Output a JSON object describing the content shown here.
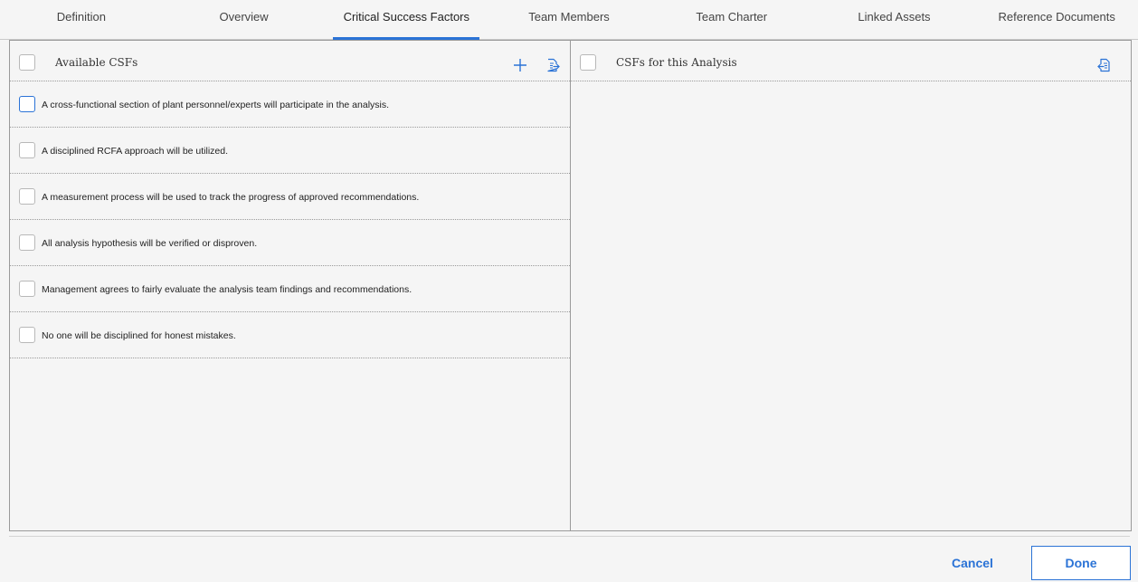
{
  "tabs": [
    {
      "label": "Definition"
    },
    {
      "label": "Overview"
    },
    {
      "label": "Critical Success Factors",
      "active": true
    },
    {
      "label": "Team Members"
    },
    {
      "label": "Team Charter"
    },
    {
      "label": "Linked Assets"
    },
    {
      "label": "Reference Documents"
    }
  ],
  "left_panel": {
    "title": "Available CSFs",
    "icons": [
      "plus-icon",
      "move-right-icon"
    ],
    "items": [
      {
        "text": "A cross-functional section of plant personnel/experts will participate in the analysis."
      },
      {
        "text": "A disciplined RCFA approach will be utilized."
      },
      {
        "text": "A measurement process will be used to track the progress of approved recommendations."
      },
      {
        "text": "All analysis hypothesis will be verified or disproven."
      },
      {
        "text": "Management agrees to fairly evaluate the analysis team findings and recommendations."
      },
      {
        "text": "No one will be disciplined for honest mistakes."
      }
    ]
  },
  "right_panel": {
    "title": "CSFs for this Analysis",
    "icons": [
      "move-left-icon"
    ],
    "items": []
  },
  "footer": {
    "cancel_label": "Cancel",
    "done_label": "Done"
  },
  "colors": {
    "accent": "#2b73d6",
    "background": "#f5f5f5",
    "border": "#9a9a9a"
  }
}
